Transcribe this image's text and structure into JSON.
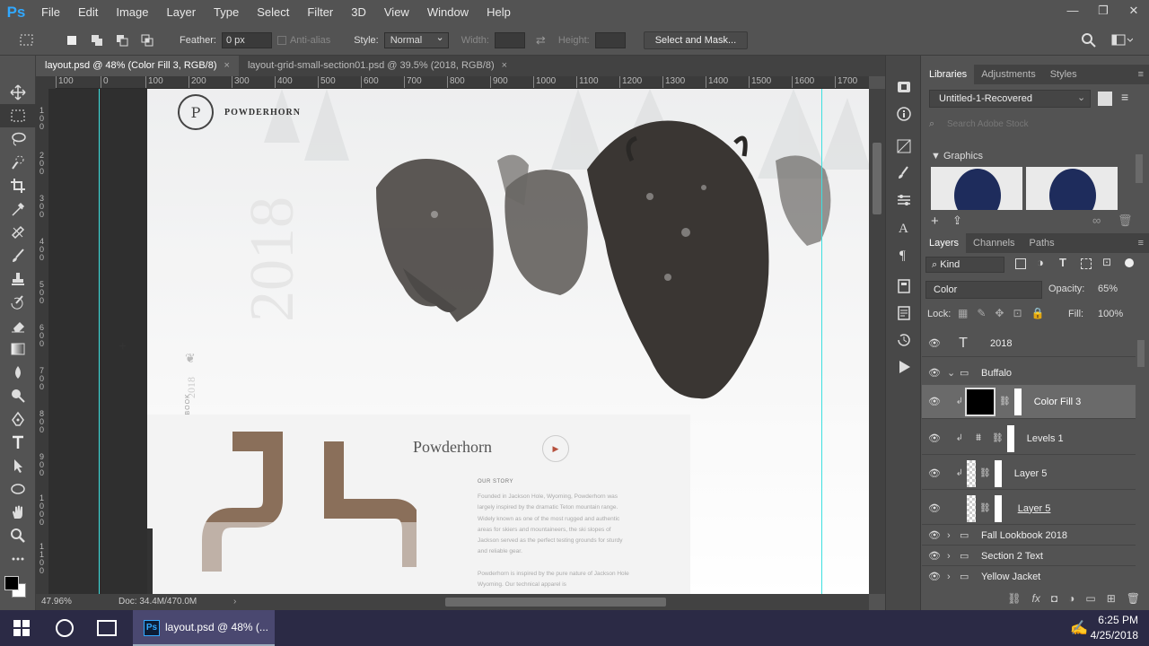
{
  "app": {
    "logo": "Ps"
  },
  "menu": [
    "File",
    "Edit",
    "Image",
    "Layer",
    "Type",
    "Select",
    "Filter",
    "3D",
    "View",
    "Window",
    "Help"
  ],
  "window_controls": [
    "—",
    "❐",
    "✕"
  ],
  "options": {
    "feather_label": "Feather:",
    "feather_value": "0 px",
    "antialias_label": "Anti-alias",
    "style_label": "Style:",
    "style_value": "Normal",
    "width_label": "Width:",
    "height_label": "Height:",
    "select_mask_label": "Select and Mask..."
  },
  "tabs": [
    {
      "label": "layout.psd @ 48% (Color Fill 3, RGB/8)",
      "close": "×"
    },
    {
      "label": "layout-grid-small-section01.psd @ 39.5% (2018, RGB/8)",
      "close": "×"
    }
  ],
  "ruler_h": [
    "100",
    "0",
    "100",
    "200",
    "300",
    "400",
    "500",
    "600",
    "700",
    "800",
    "900",
    "1000",
    "1100",
    "1200",
    "1300",
    "1400",
    "1500",
    "1600",
    "1700"
  ],
  "ruler_v": [
    "1\n0\n0",
    "2\n0\n0",
    "3\n0\n0",
    "4\n0\n0",
    "5\n0\n0",
    "6\n0\n0",
    "7\n0\n0",
    "8\n0\n0",
    "9\n0\n0",
    "1\n0\n0\n0",
    "1\n1\n0\n0"
  ],
  "document": {
    "brand": "POWDERHORN",
    "logo_text": "P",
    "year": "2018",
    "side_text": "FALL LOOKBOOK",
    "side_year": "2018",
    "card_title": "Powderhorn",
    "section_label": "OUR STORY",
    "body1": "Founded in Jackson Hole, Wyoming, Powderhorn was largely inspired by the dramatic Teton mountain range. Widely known as one of the most rugged and authentic areas for skiers and mountaineers, the ski slopes of Jackson served as the perfect testing grounds for sturdy and reliable gear.",
    "body2": "Powderhorn is inspired by the pure nature of Jackson Hole Wyoming. Our technical apparel is"
  },
  "status": {
    "zoom": "47.96%",
    "doc": "Doc: 34.4M/470.0M"
  },
  "libraries": {
    "tabs": [
      "Libraries",
      "Adjustments",
      "Styles"
    ],
    "library_name": "Untitled-1-Recovered",
    "search_placeholder": "Search Adobe Stock",
    "section": "Graphics"
  },
  "layers_panel": {
    "tabs": [
      "Layers",
      "Channels",
      "Paths"
    ],
    "kind": "Kind",
    "blend": "Color",
    "opacity_label": "Opacity:",
    "opacity": "65%",
    "lock_label": "Lock:",
    "fill_label": "Fill:",
    "fill": "100%",
    "layers": [
      {
        "name": "2018",
        "type": "text"
      },
      {
        "name": "Buffalo",
        "type": "group-open"
      },
      {
        "name": "Color Fill 3",
        "type": "fill"
      },
      {
        "name": "Levels 1",
        "type": "levels"
      },
      {
        "name": "Layer 5",
        "type": "masked"
      },
      {
        "name": "Layer 5",
        "type": "layer"
      },
      {
        "name": "Fall Lookbook 2018",
        "type": "group"
      },
      {
        "name": "Section 2 Text",
        "type": "group"
      },
      {
        "name": "Yellow Jacket",
        "type": "group"
      }
    ]
  },
  "taskbar": {
    "app_label": "layout.psd @ 48% (...",
    "time": "6:25 PM",
    "date": "4/25/2018"
  },
  "colors": {
    "bg": "#535353",
    "accent": "#31a8ff",
    "taskbar": "#2b2a45"
  }
}
